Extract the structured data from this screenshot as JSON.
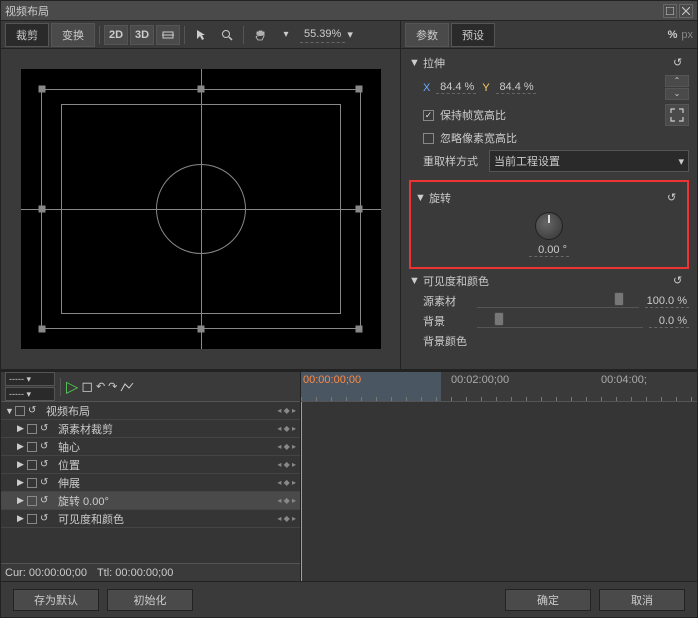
{
  "window": {
    "title": "视频布局"
  },
  "tabs": {
    "crop": "裁剪",
    "transform": "变换"
  },
  "toolbar": {
    "mode2d": "2D",
    "mode3d": "3D",
    "zoom": "55.39%"
  },
  "paramTabs": {
    "params": "参数",
    "presets": "预设",
    "pct": "%",
    "px": "px"
  },
  "stretch": {
    "title": "拉伸",
    "xLabel": "X",
    "xVal": "84.4 %",
    "yLabel": "Y",
    "yVal": "84.4 %",
    "keepAspect": "保持帧宽高比",
    "ignorePixelAspect": "忽略像素宽高比",
    "resampleLabel": "重取样方式",
    "resampleValue": "当前工程设置"
  },
  "rotate": {
    "title": "旋转",
    "value": "0.00 °"
  },
  "visibility": {
    "title": "可见度和颜色",
    "source": "源素材",
    "sourceVal": "100.0 %",
    "sourceThumb": 85,
    "bg": "背景",
    "bgVal": "0.0 %",
    "bgThumb": 10,
    "bgColor": "背景颜色"
  },
  "tracks": [
    {
      "name": "视频布局",
      "indent": 0,
      "open": true,
      "active": false
    },
    {
      "name": "源素材裁剪",
      "indent": 1,
      "open": false,
      "active": false
    },
    {
      "name": "轴心",
      "indent": 1,
      "open": false,
      "active": false
    },
    {
      "name": "位置",
      "indent": 1,
      "open": false,
      "active": false
    },
    {
      "name": "伸展",
      "indent": 1,
      "open": false,
      "active": false
    },
    {
      "name": "旋转  0.00°",
      "indent": 1,
      "open": false,
      "active": true
    },
    {
      "name": "可见度和颜色",
      "indent": 1,
      "open": false,
      "active": false
    }
  ],
  "timeline": {
    "tc1": "00:00:00;00",
    "tc2": "00:02:00;00",
    "tc3": "00:04:00;",
    "cur": "Cur: 00:00:00;00",
    "ttl": "Ttl: 00:00:00;00"
  },
  "footer": {
    "saveDefault": "存为默认",
    "init": "初始化",
    "ok": "确定",
    "cancel": "取消"
  }
}
